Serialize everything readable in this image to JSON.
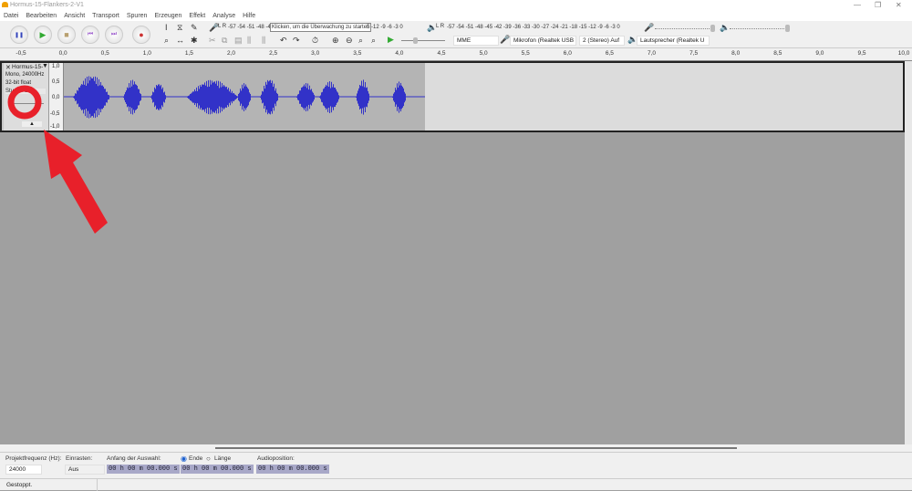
{
  "window": {
    "title": "Hormus-15-Flankers-2-V1",
    "minimize": "—",
    "maximize": "❐",
    "close": "✕"
  },
  "menu": [
    "Datei",
    "Bearbeiten",
    "Ansicht",
    "Transport",
    "Spuren",
    "Erzeugen",
    "Effekt",
    "Analyse",
    "Hilfe"
  ],
  "transport": {
    "pause": "❚❚",
    "play": "▶",
    "stop": "■",
    "skip_start": "⏮",
    "skip_end": "⏭",
    "record": "●"
  },
  "record_meter": {
    "label": "L R",
    "scale": "-57 -54 -51 -48 -4",
    "hint": "Klicken, um die Überwachung zu starten",
    "scale_end": "5 -12 -9 -6 -3 0"
  },
  "play_meter": {
    "label": "L R",
    "scale": "-57 -54 -51 -48 -45 -42 -39 -36 -33 -30 -27 -24 -21 -18 -15 -12 -9 -6 -3 0"
  },
  "devices": {
    "host": "MME",
    "mic": "Mikrofon (Realtek USB ,",
    "channels": "2 (Stereo) Auf",
    "speaker": "Lautsprecher (Realtek U"
  },
  "ruler": [
    "-0,5",
    "0,0",
    "0,5",
    "1,0",
    "1,5",
    "2,0",
    "2,5",
    "3,0",
    "3,5",
    "4,0",
    "4,5",
    "5,0",
    "5,5",
    "6,0",
    "6,5",
    "7,0",
    "7,5",
    "8,0",
    "8,5",
    "9,0",
    "9,5",
    "10,0"
  ],
  "track": {
    "name": "Hormus-15-",
    "info1": "Mono, 24000Hz",
    "info2": "32-bit float",
    "buttons": "Stumm  Solo",
    "collapse": "▲",
    "vscale": [
      "1,0",
      "0,5",
      "0,0",
      "-0,5",
      "-1,0"
    ]
  },
  "selection": {
    "rate_label": "Projektfrequenz (Hz):",
    "rate": "24000",
    "snap_label": "Einrasten:",
    "snap": "Aus",
    "start_label": "Anfang der Auswahl:",
    "end_label": "Ende",
    "length_label": "Länge",
    "start": "00 h 00 m 00.000 s",
    "end": "00 h 00 m 00.000 s",
    "pos_label": "Audioposition:",
    "pos": "00 h 00 m 00.000 s"
  },
  "status": "Gestoppt.",
  "colors": {
    "wave": "#3232c8",
    "annotation": "#e8202a"
  }
}
